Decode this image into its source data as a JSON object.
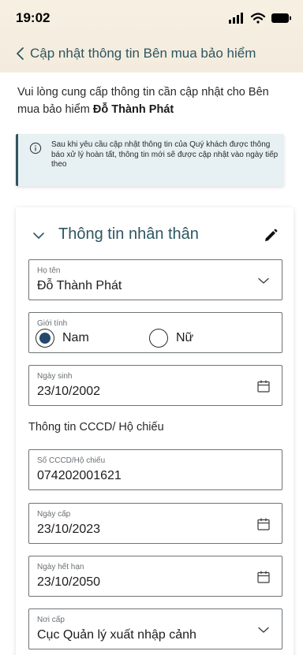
{
  "status_bar": {
    "time": "19:02",
    "icons": [
      "signal-icon",
      "wifi-icon",
      "battery-icon"
    ]
  },
  "nav": {
    "title": "Cập nhật thông tin Bên mua bảo hiểm",
    "back_icon": "chevron-left-icon"
  },
  "intro": {
    "text": "Vui lòng cung cấp thông tin cần cập nhật cho Bên mua bảo hiểm ",
    "name": "Đỗ Thành Phát"
  },
  "notice": {
    "icon": "info-icon",
    "text": "Sau khi yêu cầu cập nhật thông tin của Quý khách được thông báo xử lý hoàn tất, thông tin mới sẽ được cập nhật vào ngày tiếp theo"
  },
  "personal_section": {
    "title": "Thông tin nhân thân",
    "full_name": {
      "label": "Họ tên",
      "value": "Đỗ Thành Phát"
    },
    "gender": {
      "label": "Giới tính",
      "options": [
        "Nam",
        "Nữ"
      ],
      "selected": "Nam"
    },
    "dob": {
      "label": "Ngày sinh",
      "value": "23/10/2002"
    },
    "id_heading": "Thông tin CCCD/ Hộ chiếu",
    "id_number": {
      "label": "Số CCCD/Hộ chiếu",
      "value": "074202001621"
    },
    "issue_date": {
      "label": "Ngày cấp",
      "value": "23/10/2023"
    },
    "expiry_date": {
      "label": "Ngày hết hạn",
      "value": "23/10/2050"
    },
    "issue_place": {
      "label": "Nơi cấp",
      "value": "Cục Quản lý xuất nhập cảnh"
    }
  },
  "colors": {
    "accent": "#2f5560",
    "radio_selected": "#24496a",
    "notice_bg": "#e7f0f2",
    "header_bg": "#f4eee2"
  }
}
